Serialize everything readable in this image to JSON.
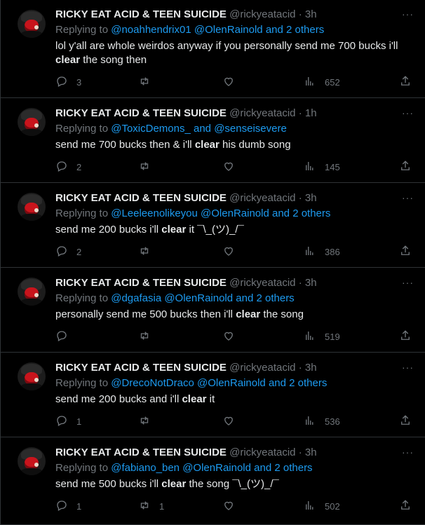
{
  "tweets": [
    {
      "name": "RICKY EAT ACID & TEEN SUICIDE",
      "handle": "@rickyeatacid",
      "dot": "·",
      "time": "3h",
      "more": "···",
      "replying_prefix": "Replying to",
      "replying_users": "@noahhendrix01 @OlenRainold",
      "replying_and": "and",
      "replying_others": "2 others",
      "body_pre": "lol y'all are whole weirdos anyway if you personally  send me 700 bucks i'll ",
      "body_bold": "clear",
      "body_post": " the song then",
      "replies": "3",
      "retweets": "",
      "likes": "",
      "views": "652"
    },
    {
      "name": "RICKY EAT ACID & TEEN SUICIDE",
      "handle": "@rickyeatacid",
      "dot": "·",
      "time": "1h",
      "more": "···",
      "replying_prefix": "Replying to",
      "replying_users": "@ToxicDemons_",
      "replying_and": "and",
      "replying_others": "@senseisevere",
      "body_pre": "send me 700 bucks then & i'll ",
      "body_bold": "clear",
      "body_post": " his dumb song",
      "replies": "2",
      "retweets": "",
      "likes": "",
      "views": "145"
    },
    {
      "name": "RICKY EAT ACID & TEEN SUICIDE",
      "handle": "@rickyeatacid",
      "dot": "·",
      "time": "3h",
      "more": "···",
      "replying_prefix": "Replying to",
      "replying_users": "@Leeleenolikeyou @OlenRainold",
      "replying_and": "and",
      "replying_others": "2 others",
      "body_pre": "send me 200 bucks i'll ",
      "body_bold": "clear",
      "body_post": " it ¯\\_(ツ)_/¯",
      "replies": "2",
      "retweets": "",
      "likes": "",
      "views": "386"
    },
    {
      "name": "RICKY EAT ACID & TEEN SUICIDE",
      "handle": "@rickyeatacid",
      "dot": "·",
      "time": "3h",
      "more": "···",
      "replying_prefix": "Replying to",
      "replying_users": "@dgafasia @OlenRainold",
      "replying_and": "and",
      "replying_others": "2 others",
      "body_pre": "personally send me 500 bucks then i'll ",
      "body_bold": "clear",
      "body_post": " the song",
      "replies": "",
      "retweets": "",
      "likes": "",
      "views": "519"
    },
    {
      "name": "RICKY EAT ACID & TEEN SUICIDE",
      "handle": "@rickyeatacid",
      "dot": "·",
      "time": "3h",
      "more": "···",
      "replying_prefix": "Replying to",
      "replying_users": "@DrecoNotDraco @OlenRainold",
      "replying_and": "and",
      "replying_others": "2 others",
      "body_pre": "send me 200 bucks and i'll ",
      "body_bold": "clear",
      "body_post": " it",
      "replies": "1",
      "retweets": "",
      "likes": "",
      "views": "536"
    },
    {
      "name": "RICKY EAT ACID & TEEN SUICIDE",
      "handle": "@rickyeatacid",
      "dot": "·",
      "time": "3h",
      "more": "···",
      "replying_prefix": "Replying to",
      "replying_users": "@fabiano_ben @OlenRainold",
      "replying_and": "and",
      "replying_others": "2 others",
      "body_pre": "send me 500 bucks i'll ",
      "body_bold": "clear",
      "body_post": " the song ¯\\_(ツ)_/¯",
      "replies": "1",
      "retweets": "1",
      "likes": "",
      "views": "502"
    }
  ],
  "icons": {
    "reply": "reply-icon",
    "retweet": "retweet-icon",
    "like": "heart-icon",
    "views": "views-icon",
    "share": "share-icon",
    "more": "more-icon"
  },
  "colors": {
    "background": "#000000",
    "text": "#e7e9ea",
    "muted": "#71767b",
    "link": "#1d9bf0",
    "divider": "#2f3336"
  }
}
